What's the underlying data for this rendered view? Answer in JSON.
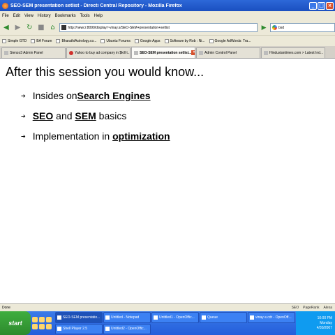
{
  "window": {
    "title": "SEO-SEM presentation setlist - Directi Central Repository - Mozilla Firefox",
    "minimize": "_",
    "maximize": "□",
    "close": "×"
  },
  "menu": [
    "File",
    "Edit",
    "View",
    "History",
    "Bookmarks",
    "Tools",
    "Help"
  ],
  "nav": {
    "back": "◀",
    "forward": "▶",
    "reload": "↻",
    "stop": "■",
    "home": "⌂",
    "url": "http://newcr:8090/display/~vinay.s/SEO-SEM+presentation+setlist",
    "go": "▶",
    "search_value": "bsd"
  },
  "bookmarks": [
    "Simple GTD",
    "BA Forum",
    "BharathiAstrology.co...",
    "Ubuntu Forums",
    "Google Apps",
    "Software by Rob : Ni...",
    "Google AdWords: Tra..."
  ],
  "tabs": [
    {
      "label": "Sienzo3 Admin Panel",
      "active": false
    },
    {
      "label": "Yahoo to buy ad company in $kill t...",
      "active": false
    },
    {
      "label": "SEO-SEM presentation setlist...",
      "active": true
    },
    {
      "label": "Admin Control Panel",
      "active": false
    },
    {
      "label": "Hindustantimes.com > Latest Ind...",
      "active": false
    }
  ],
  "slide": {
    "heading": "After this session you would know...",
    "bullets": [
      {
        "pre": "Insides on ",
        "bold": "Search Engines",
        "post": ""
      },
      {
        "pre": "",
        "bold": "SEO",
        "mid": " and ",
        "bold2": "SEM",
        "post": " basics"
      },
      {
        "pre": "Implementation in ",
        "bold": "optimization",
        "post": ""
      }
    ]
  },
  "status": {
    "text": "Done",
    "right": [
      "SEO",
      "PageRank",
      "Alexa"
    ]
  },
  "taskbar": {
    "start": "start",
    "buttons": [
      "SEO-SEM presentatio...",
      "Untitled - Notepad",
      "Untitled1 - OpenOffic...",
      "Queue",
      "vinay-s.cdr - OpenOff...",
      "Shell Player 2.5",
      "Untitled2 - OpenOffic..."
    ],
    "time": "10:00 PM",
    "day": "Monday",
    "date": "4/30/2007"
  }
}
